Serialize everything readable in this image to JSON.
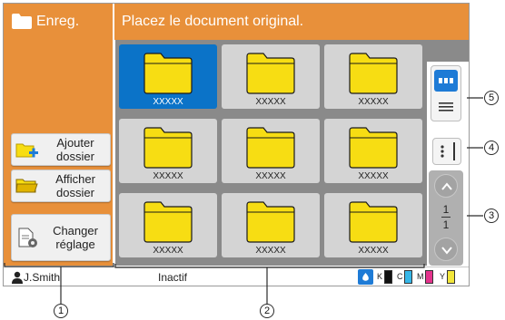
{
  "left_header": {
    "title": "Enreg.",
    "icon": "folder-icon"
  },
  "header": {
    "message": "Placez le document original."
  },
  "left_buttons": [
    {
      "label": "Ajouter\ndossier",
      "icon": "add-folder-icon"
    },
    {
      "label": "Afficher\ndossier",
      "icon": "open-folder-icon"
    },
    {
      "label": "Changer\nréglage",
      "icon": "settings-document-icon"
    }
  ],
  "folders": [
    {
      "label": "XXXXX",
      "selected": true
    },
    {
      "label": "XXXXX",
      "selected": false
    },
    {
      "label": "XXXXX",
      "selected": false
    },
    {
      "label": "XXXXX",
      "selected": false
    },
    {
      "label": "XXXXX",
      "selected": false
    },
    {
      "label": "XXXXX",
      "selected": false
    },
    {
      "label": "XXXXX",
      "selected": false
    },
    {
      "label": "XXXXX",
      "selected": false
    },
    {
      "label": "XXXXX",
      "selected": false
    }
  ],
  "view_toggle": {
    "active": "grid",
    "icons": [
      "grid-view-icon",
      "list-view-icon"
    ]
  },
  "more_button": {
    "icon": "more-vertical-icon"
  },
  "pager": {
    "current": "1",
    "total": "1",
    "icons": [
      "chevron-up-icon",
      "chevron-down-icon"
    ]
  },
  "status_bar": {
    "user": "J.Smith",
    "status": "Inactif",
    "ink": [
      {
        "label": "K",
        "color": "#111111"
      },
      {
        "label": "C",
        "color": "#36b7e8"
      },
      {
        "label": "M",
        "color": "#e3338c"
      },
      {
        "label": "Y",
        "color": "#f2e63a"
      }
    ]
  },
  "callouts": [
    "1",
    "2",
    "3",
    "4",
    "5"
  ],
  "colors": {
    "accent": "#e8903a",
    "selected": "#0b73c8",
    "folder": "#f7dd13",
    "grid_bg": "#8a8a8a",
    "tile": "#d4d4d4"
  }
}
